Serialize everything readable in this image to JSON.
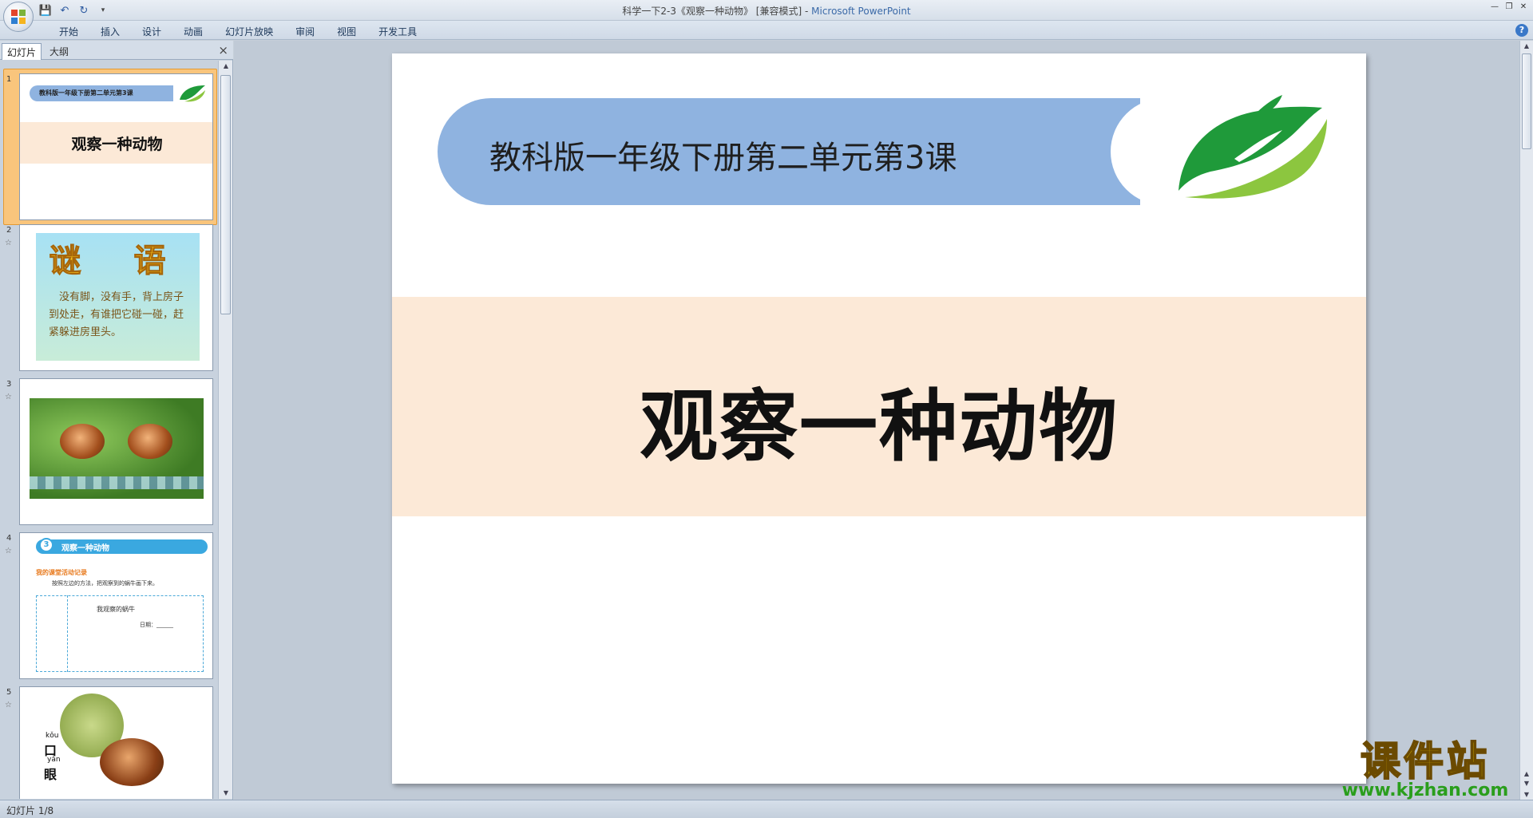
{
  "window": {
    "title": "科学一下2-3《观察一种动物》 [兼容模式] - ",
    "app_name": "Microsoft PowerPoint"
  },
  "ribbon": {
    "tabs": [
      "开始",
      "插入",
      "设计",
      "动画",
      "幻灯片放映",
      "审阅",
      "视图",
      "开发工具"
    ],
    "help": "?"
  },
  "left_panel": {
    "tabs": {
      "slides": "幻灯片",
      "outline": "大纲"
    },
    "close": "×",
    "thumbnails": [
      {
        "num": "1",
        "banner": "教科版一年级下册第二单元第3课",
        "title": "观察一种动物"
      },
      {
        "num": "2",
        "star": "☆",
        "heading": "谜 语",
        "body": "　没有脚，没有手，背上房子到处走，有谁把它碰一碰，赶紧躲进房里头。"
      },
      {
        "num": "3",
        "star": "☆"
      },
      {
        "num": "4",
        "star": "☆",
        "lesson_num": "3",
        "bar": "观察一种动物",
        "sub": "我的课堂活动记录",
        "line": "按照左边的方法，把观察到的蜗牛画下来。",
        "record": "我观察的蜗牛",
        "date": "日期：______"
      },
      {
        "num": "5",
        "star": "☆",
        "py1": "kǒu",
        "ch1": "口",
        "py2": "yǎn",
        "ch2": "眼"
      }
    ]
  },
  "slide": {
    "banner_text": "教科版一年级下册第二单元第3课",
    "title": "观察一种动物"
  },
  "watermark": {
    "cn": "课件站",
    "url": "www.kjzhan.com"
  },
  "status": {
    "slide_counter": "幻灯片 1/8"
  },
  "colors": {
    "banner": "#8fb3e0",
    "title_band": "#fce9d7",
    "selection": "#f9c57c"
  }
}
